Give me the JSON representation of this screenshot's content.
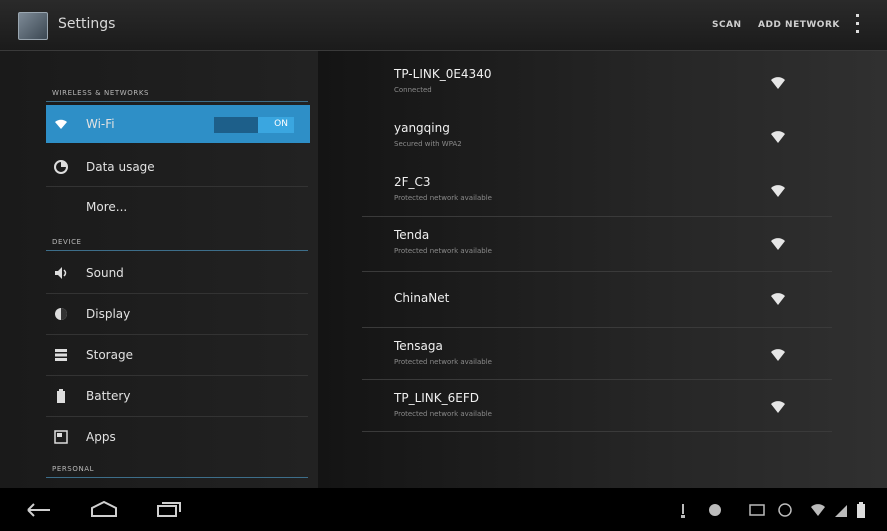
{
  "actionbar": {
    "title": "Settings",
    "actions": [
      "SCAN",
      "ADD NETWORK"
    ]
  },
  "sidebar": {
    "sections": {
      "wireless": "WIRELESS & NETWORKS",
      "device": "DEVICE",
      "personal": "PERSONAL"
    },
    "items": [
      {
        "label": "Wi-Fi",
        "icon": "wifi-icon",
        "toggle": "ON"
      },
      {
        "label": "Data usage",
        "icon": "data-usage-icon"
      },
      {
        "label": "More..."
      },
      {
        "label": "Sound",
        "icon": "speaker-icon"
      },
      {
        "label": "Display",
        "icon": "display-icon"
      },
      {
        "label": "Storage",
        "icon": "storage-icon"
      },
      {
        "label": "Battery",
        "icon": "battery-icon"
      },
      {
        "label": "Apps",
        "icon": "apps-icon"
      }
    ]
  },
  "networks": [
    {
      "ssid": "TP-LINK_0E4340",
      "status": "Connected",
      "secured": false
    },
    {
      "ssid": "yangqing",
      "status": "Secured with WPA2",
      "secured": false
    },
    {
      "ssid": "2F_C3",
      "status": "Protected network available",
      "secured": true
    },
    {
      "ssid": "Tenda",
      "status": "Protected network available",
      "secured": true
    },
    {
      "ssid": "ChinaNet",
      "status": "",
      "secured": true
    },
    {
      "ssid": "Tensaga",
      "status": "Protected network available",
      "secured": true
    },
    {
      "ssid": "TP_LINK_6EFD",
      "status": "Protected network available",
      "secured": true
    }
  ],
  "colors": {
    "accent": "#2e8fc7",
    "background": "#0a0a0a"
  }
}
